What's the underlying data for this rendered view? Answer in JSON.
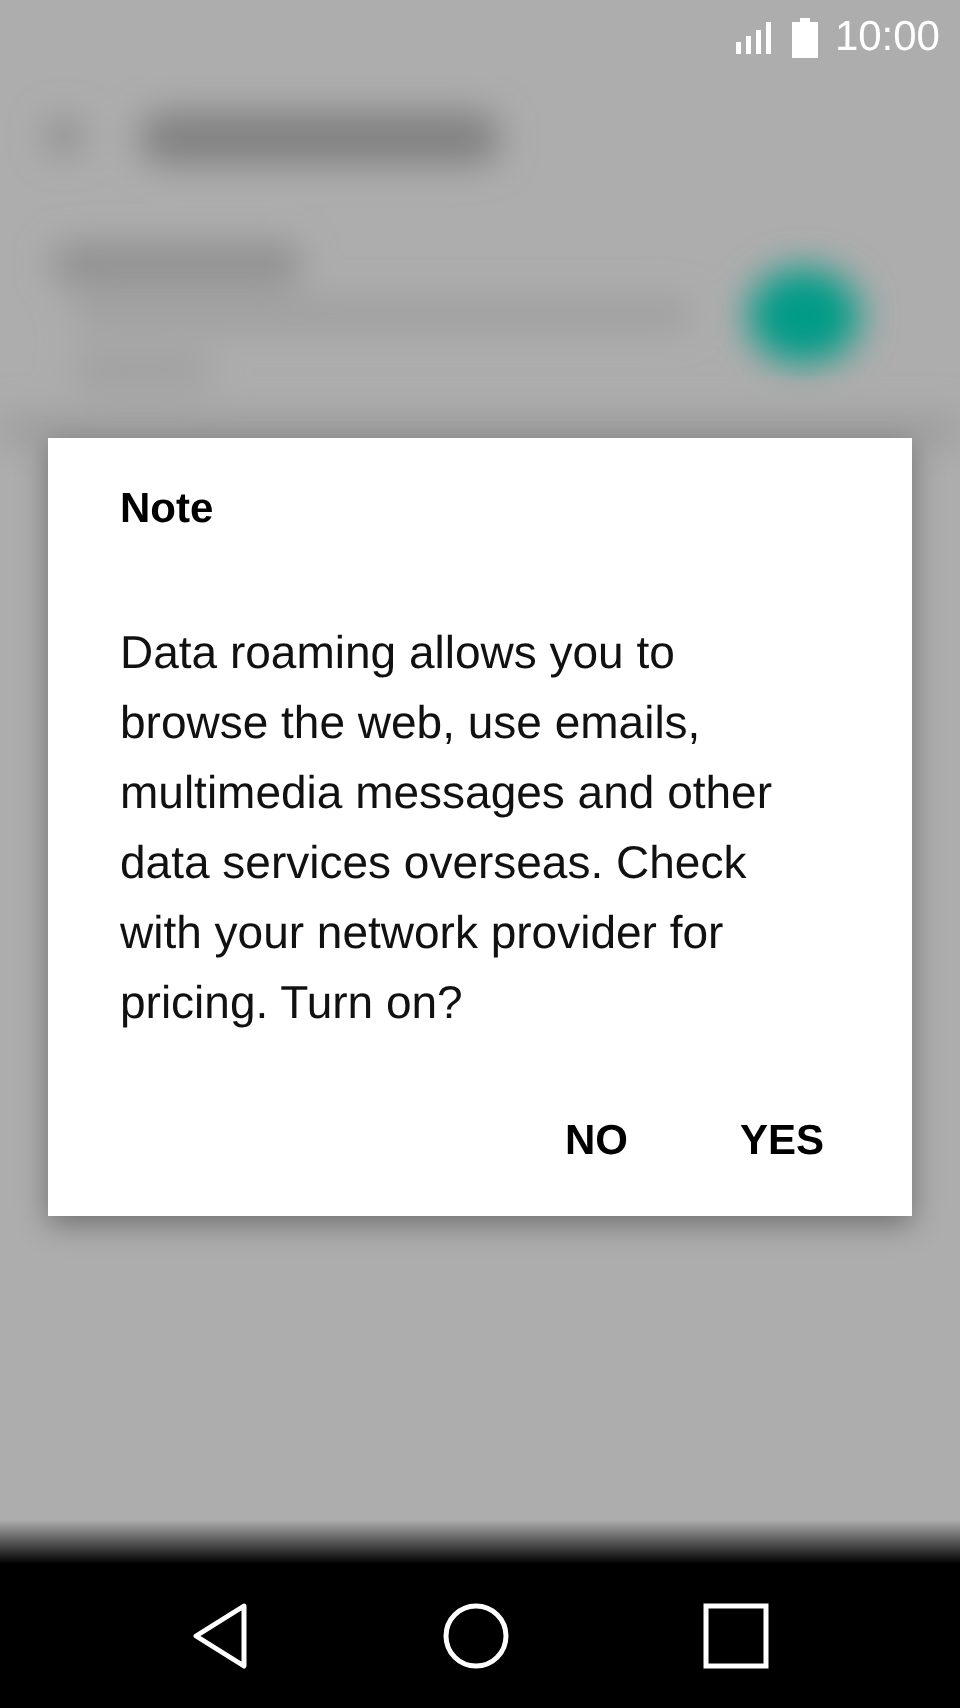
{
  "status_bar": {
    "time": "10:00"
  },
  "dialog": {
    "title": "Note",
    "message": "Data roaming allows you to browse the web, use emails, multimedia messages and other data services overseas. Check with your network provider for pricing. Turn on?",
    "buttons": [
      "NO",
      "YES"
    ]
  }
}
